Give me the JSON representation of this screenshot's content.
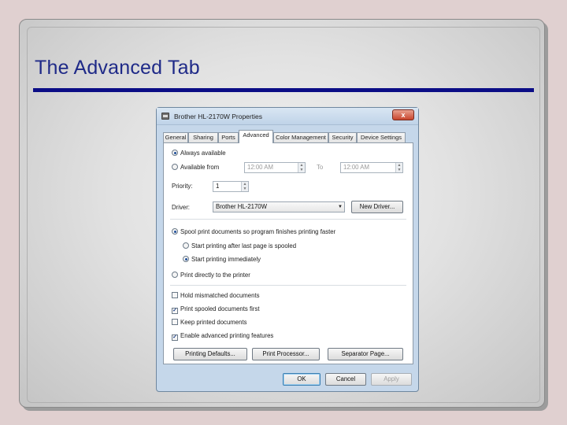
{
  "slide": {
    "title": "The Advanced Tab"
  },
  "dialog": {
    "title": "Brother HL-2170W Properties",
    "close_label": "x",
    "tabs": [
      {
        "label": "General"
      },
      {
        "label": "Sharing"
      },
      {
        "label": "Ports"
      },
      {
        "label": "Advanced"
      },
      {
        "label": "Color Management"
      },
      {
        "label": "Security"
      },
      {
        "label": "Device Settings"
      }
    ],
    "active_tab": "Advanced",
    "availability": {
      "always_label": "Always available",
      "from_label": "Available from",
      "from_time": "12:00 AM",
      "to_label": "To",
      "to_time": "12:00 AM",
      "selected": "always"
    },
    "priority": {
      "label": "Priority:",
      "value": "1"
    },
    "driver": {
      "label": "Driver:",
      "value": "Brother HL-2170W",
      "new_driver_label": "New Driver..."
    },
    "spooling": {
      "spool_label": "Spool print documents so program finishes printing faster",
      "after_last_label": "Start printing after last page is spooled",
      "immediately_label": "Start printing immediately",
      "direct_label": "Print directly to the printer",
      "selected_mode": "spool",
      "selected_start": "immediately"
    },
    "options": [
      {
        "label": "Hold mismatched documents",
        "checked": false
      },
      {
        "label": "Print spooled documents first",
        "checked": true
      },
      {
        "label": "Keep printed documents",
        "checked": false
      },
      {
        "label": "Enable advanced printing features",
        "checked": true
      }
    ],
    "bottom_buttons": {
      "defaults": "Printing Defaults...",
      "processor": "Print Processor...",
      "separator": "Separator Page..."
    },
    "footer_buttons": {
      "ok": "OK",
      "cancel": "Cancel",
      "apply": "Apply"
    }
  }
}
